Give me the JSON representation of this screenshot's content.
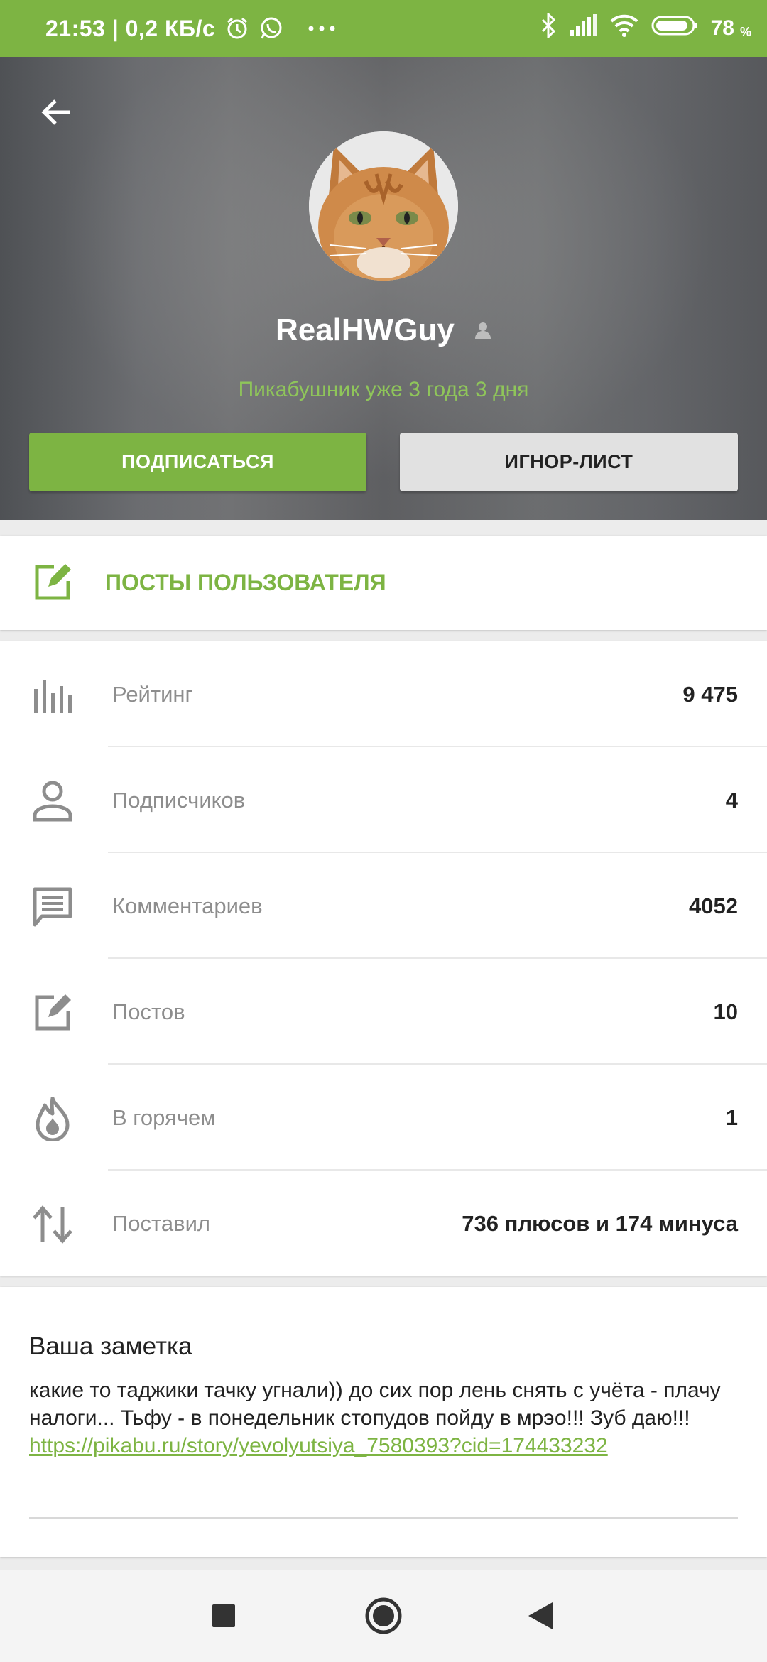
{
  "status_bar": {
    "time_speed": "21:53 | 0,2 КБ/с",
    "battery": "78",
    "battery_unit": "%",
    "icons": [
      "alarm-icon",
      "whatsapp-icon",
      "more-dots-icon",
      "bluetooth-icon",
      "signal-icon",
      "wifi-icon",
      "battery-icon"
    ]
  },
  "profile": {
    "username": "RealHWGuy",
    "tenure": "Пикабушник уже 3 года 3 дня",
    "subscribe_label": "ПОДПИСАТЬСЯ",
    "ignore_label": "ИГНОР-ЛИСТ"
  },
  "posts_section": {
    "label": "ПОСТЫ ПОЛЬЗОВАТЕЛЯ"
  },
  "stats": [
    {
      "icon": "rating-bars-icon",
      "label": "Рейтинг",
      "value": "9 475"
    },
    {
      "icon": "person-icon",
      "label": "Подписчиков",
      "value": "4"
    },
    {
      "icon": "comment-icon",
      "label": "Комментариев",
      "value": "4052"
    },
    {
      "icon": "edit-icon",
      "label": "Постов",
      "value": "10"
    },
    {
      "icon": "flame-icon",
      "label": "В горячем",
      "value": "1"
    },
    {
      "icon": "up-down-arrows-icon",
      "label": "Поставил",
      "value": "736 плюсов и 174 минуса"
    }
  ],
  "note": {
    "title": "Ваша заметка",
    "text": "какие то таджики тачку угнали)) до сих пор лень снять с учёта - плачу налоги... Тьфу - в понедельник стопудов пойду в мрэо!!! Зуб даю!!!",
    "link": "https://pikabu.ru/story/yevolyutsiya_7580393?cid=174433232"
  },
  "colors": {
    "accent": "#7db443",
    "status_bar": "#7db443",
    "ignore_button": "#e1e1e1",
    "stat_label": "#8d8d8d"
  }
}
